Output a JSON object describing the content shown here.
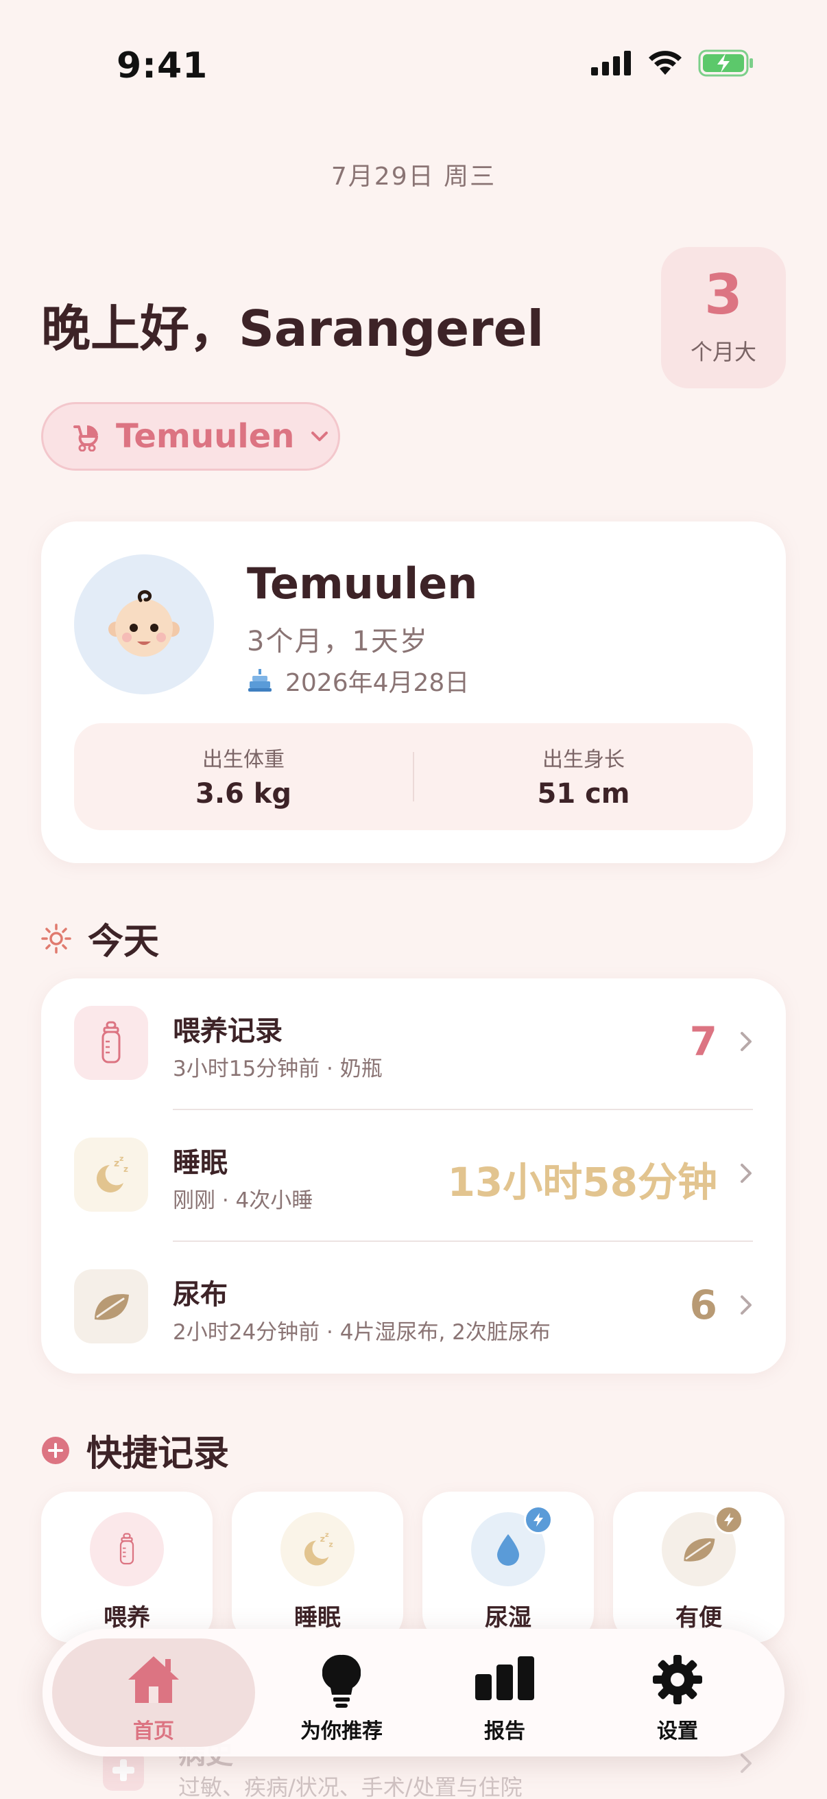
{
  "status_bar": {
    "time": "9:41"
  },
  "header": {
    "date": "7月29日 周三",
    "greeting": "晚上好，Sarangerel",
    "age_number": "3",
    "age_unit": "个月大"
  },
  "baby_selector": {
    "name": "Temuulen"
  },
  "profile": {
    "name": "Temuulen",
    "age": "3个月，1天岁",
    "birthday": "2026年4月28日",
    "birth_weight_label": "出生体重",
    "birth_weight": "3.6 kg",
    "birth_length_label": "出生身长",
    "birth_length": "51 cm"
  },
  "today": {
    "title": "今天",
    "rows": [
      {
        "title": "喂养记录",
        "subtitle": "3小时15分钟前 · 奶瓶",
        "value": "7",
        "color": "#dc7482",
        "icon": "bottle-icon"
      },
      {
        "title": "睡眠",
        "subtitle": "刚刚 · 4次小睡",
        "value": "13小时58分钟",
        "color": "#e2c48f",
        "icon": "moon-sleep-icon"
      },
      {
        "title": "尿布",
        "subtitle": "2小时24分钟前 · 4片湿尿布, 2次脏尿布",
        "value": "6",
        "color": "#b89a74",
        "icon": "leaf-icon"
      }
    ]
  },
  "quick_log": {
    "title": "快捷记录",
    "items": [
      {
        "label": "喂养",
        "icon": "bottle-icon"
      },
      {
        "label": "睡眠",
        "icon": "moon-sleep-icon"
      },
      {
        "label": "尿湿",
        "icon": "droplet-icon"
      },
      {
        "label": "有便",
        "icon": "leaf-icon"
      }
    ]
  },
  "health": {
    "title": "病史",
    "subtitle": "过敏、疾病/状况、手术/处置与住院"
  },
  "tab_bar": {
    "tabs": [
      {
        "label": "首页",
        "icon": "home-icon"
      },
      {
        "label": "为你推荐",
        "icon": "lightbulb-icon"
      },
      {
        "label": "报告",
        "icon": "bar-chart-icon"
      },
      {
        "label": "设置",
        "icon": "gear-icon"
      }
    ]
  },
  "colors": {
    "background": "#fcf3f1",
    "accent": "#dc7482",
    "sleep": "#e2c48f",
    "diaper": "#b89a74",
    "text": "#3d2327"
  }
}
